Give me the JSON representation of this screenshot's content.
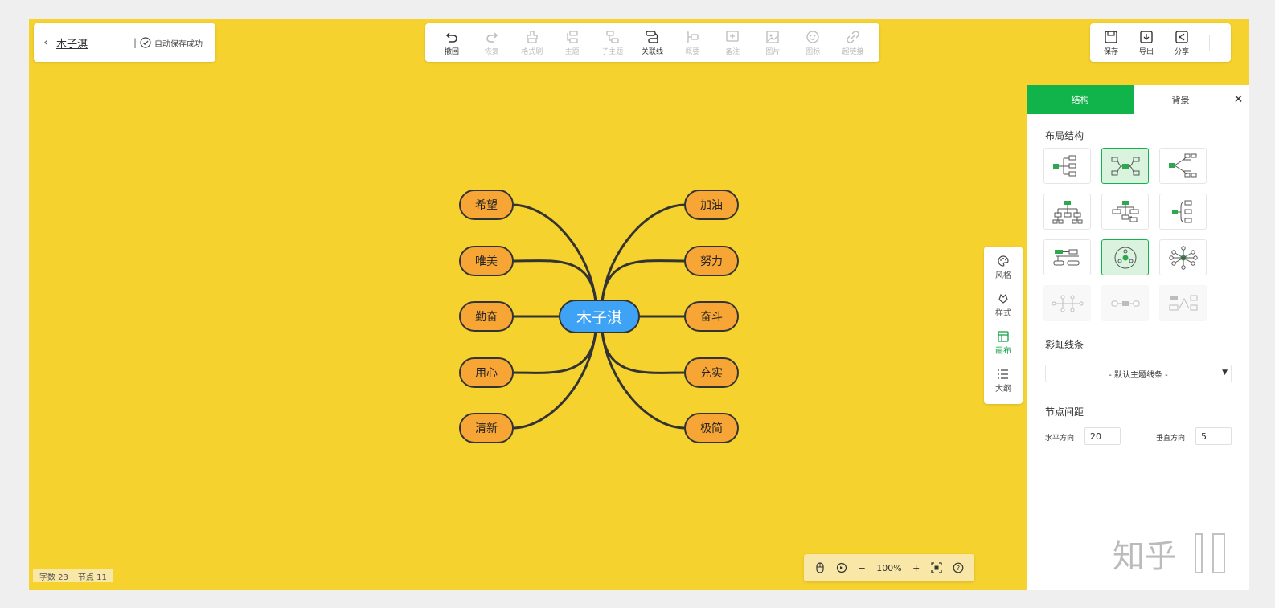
{
  "header": {
    "back_icon": "chevron-left-icon",
    "title": "木子淇",
    "separator": "|",
    "save_status": "自动保存成功"
  },
  "toolbar": {
    "items": [
      {
        "label": "撤回",
        "icon": "undo-icon",
        "enabled": true
      },
      {
        "label": "恢复",
        "icon": "redo-icon",
        "enabled": false
      },
      {
        "label": "格式刷",
        "icon": "format-brush-icon",
        "enabled": false
      },
      {
        "label": "主题",
        "icon": "topic-icon",
        "enabled": false
      },
      {
        "label": "子主题",
        "icon": "subtopic-icon",
        "enabled": false
      },
      {
        "label": "关联线",
        "icon": "relation-line-icon",
        "enabled": true
      },
      {
        "label": "概要",
        "icon": "summary-icon",
        "enabled": false
      },
      {
        "label": "备注",
        "icon": "note-icon",
        "enabled": false
      },
      {
        "label": "图片",
        "icon": "image-icon",
        "enabled": false
      },
      {
        "label": "图标",
        "icon": "emoji-icon",
        "enabled": false
      },
      {
        "label": "超链接",
        "icon": "link-icon",
        "enabled": false
      }
    ]
  },
  "actions": {
    "save": "保存",
    "export": "导出",
    "share": "分享"
  },
  "mindmap": {
    "root": "木子淇",
    "left": [
      "希望",
      "唯美",
      "勤奋",
      "用心",
      "清新"
    ],
    "right": [
      "加油",
      "努力",
      "奋斗",
      "充实",
      "极简"
    ],
    "colors": {
      "canvas": "#f5d22e",
      "node": "#f7a534",
      "root": "#3fa3f5",
      "line": "#333333"
    }
  },
  "sidebar": {
    "items": [
      {
        "label": "风格",
        "icon": "palette-icon",
        "active": false
      },
      {
        "label": "样式",
        "icon": "style-icon",
        "active": false
      },
      {
        "label": "画布",
        "icon": "canvas-icon",
        "active": true
      },
      {
        "label": "大纲",
        "icon": "outline-icon",
        "active": false
      }
    ]
  },
  "panel": {
    "tabs": [
      "结构",
      "背景"
    ],
    "close_icon": "close-icon",
    "layout_title": "布局结构",
    "rainbow_title": "彩虹线条",
    "rainbow_value": "- 默认主题线条 -",
    "spacing_title": "节点间距",
    "horizontal_label": "水平方向",
    "horizontal_value": "20",
    "vertical_label": "垂直方向",
    "vertical_value": "5",
    "accent": "#11b44a"
  },
  "zoom": {
    "value": "100%",
    "minus": "−",
    "plus": "+"
  },
  "stats": {
    "words": "字数 23",
    "nodes": "节点 11"
  },
  "watermark": {
    "text": "知乎"
  }
}
